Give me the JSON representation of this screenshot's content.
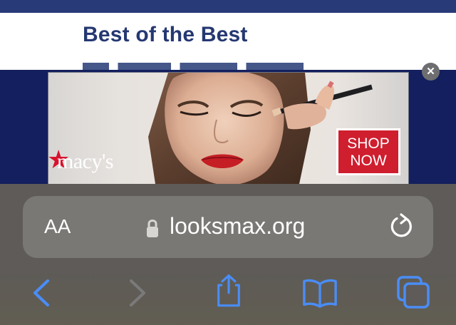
{
  "page": {
    "headline": "Best of the Best"
  },
  "ad": {
    "brand": "macy's",
    "cta": "SHOP NOW",
    "close_label": "✕"
  },
  "browser": {
    "text_size_label": "AA",
    "url": "looksmax.org"
  },
  "icons": {
    "back": "chevron-left-icon",
    "forward": "chevron-right-icon",
    "share": "share-icon",
    "bookmarks": "book-icon",
    "tabs": "tabs-icon",
    "lock": "lock-icon",
    "reload": "reload-icon"
  },
  "colors": {
    "header_bg": "#283a78",
    "headline_text": "#253872",
    "ad_band_bg": "#131f5e",
    "ad_cta_bg": "#cf1e2e",
    "toolbar_bg": "#5e5b58",
    "address_bar_bg": "#7a7875",
    "active_icon": "#4a8df7",
    "disabled_icon": "#7b7a7a"
  }
}
